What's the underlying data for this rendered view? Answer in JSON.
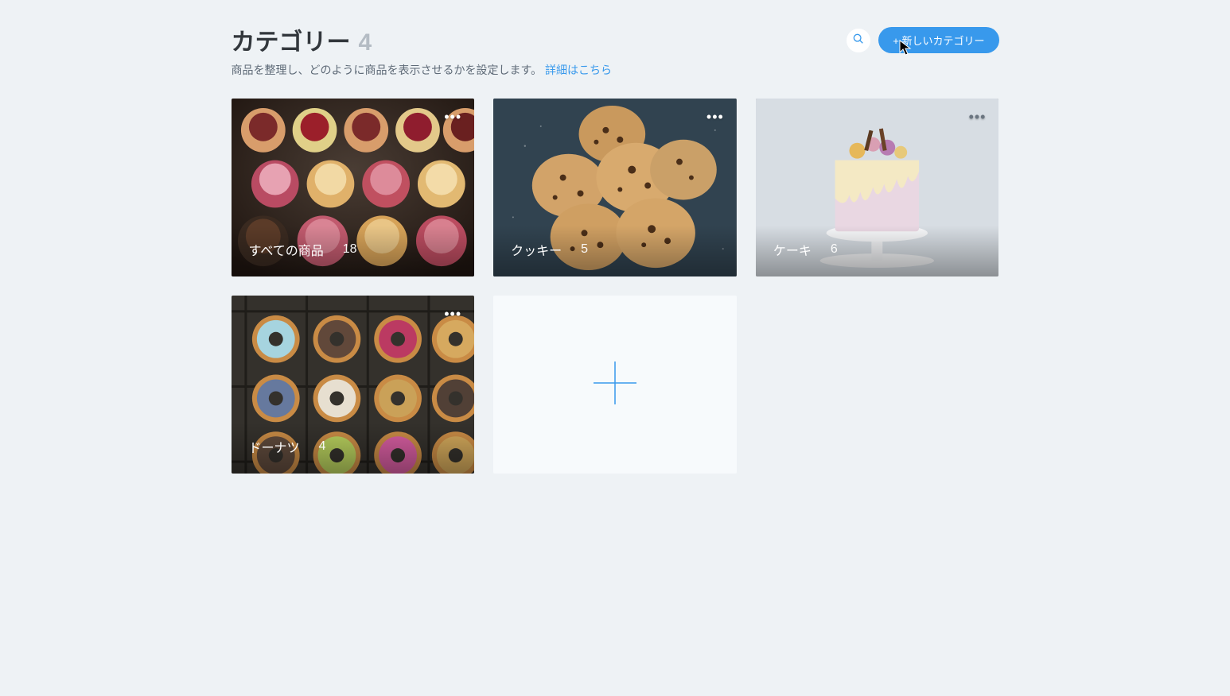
{
  "header": {
    "title": "カテゴリー",
    "count": "4",
    "subtitle_prefix": "商品を整理し、どのように商品を表示させるかを設定します。",
    "learn_more": "詳細はこちら",
    "new_button": "+ 新しいカテゴリー"
  },
  "categories": [
    {
      "name": "すべての商品",
      "count": "18"
    },
    {
      "name": "クッキー",
      "count": "5"
    },
    {
      "name": "ケーキ",
      "count": "6"
    },
    {
      "name": "ドーナツ",
      "count": "4"
    }
  ],
  "icons": {
    "search": "search-icon",
    "more": "more-icon",
    "plus": "plus-icon"
  },
  "colors": {
    "accent": "#3899ec",
    "bg": "#eef2f5",
    "muted": "#b4bcc4"
  }
}
